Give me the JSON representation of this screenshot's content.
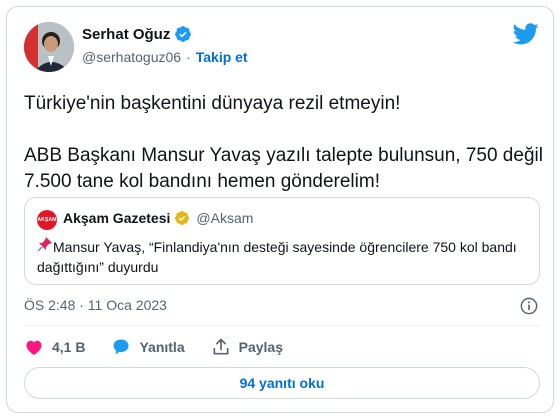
{
  "author": {
    "name": "Serhat Oğuz",
    "handle": "@serhatoguz06",
    "separator": "·",
    "follow_label": "Takip et"
  },
  "tweet": {
    "line1": "Türkiye'nin başkentini dünyaya rezil etmeyin!",
    "line2": "ABB Başkanı Mansur Yavaş yazılı talepte bulunsun, 750 değil 7.500 tane kol bandını hemen gönderelim!"
  },
  "quote": {
    "avatar_text": "AKŞAM",
    "name": "Akşam Gazetesi",
    "handle": "@Aksam",
    "text": "Mansur Yavaş, “Finlandiya'nın desteği sayesinde öğrencilere 750 kol bandı dağıttığını” duyurdu"
  },
  "meta": {
    "timestamp": "ÖS 2:48 · 11 Oca 2023"
  },
  "actions": {
    "like_count": "4,1 B",
    "reply_label": "Yanıtla",
    "share_label": "Paylaş"
  },
  "read_replies_label": "94 yanıtı oku",
  "colors": {
    "accent": "#1d9bf0",
    "like": "#f91880",
    "link": "#006fd6",
    "gold_badge": "#e2b719"
  },
  "icons": [
    "verified-badge-icon",
    "twitter-bird-icon",
    "gold-verified-icon",
    "pin-icon",
    "info-icon",
    "heart-icon",
    "reply-bubble-icon",
    "share-icon"
  ]
}
